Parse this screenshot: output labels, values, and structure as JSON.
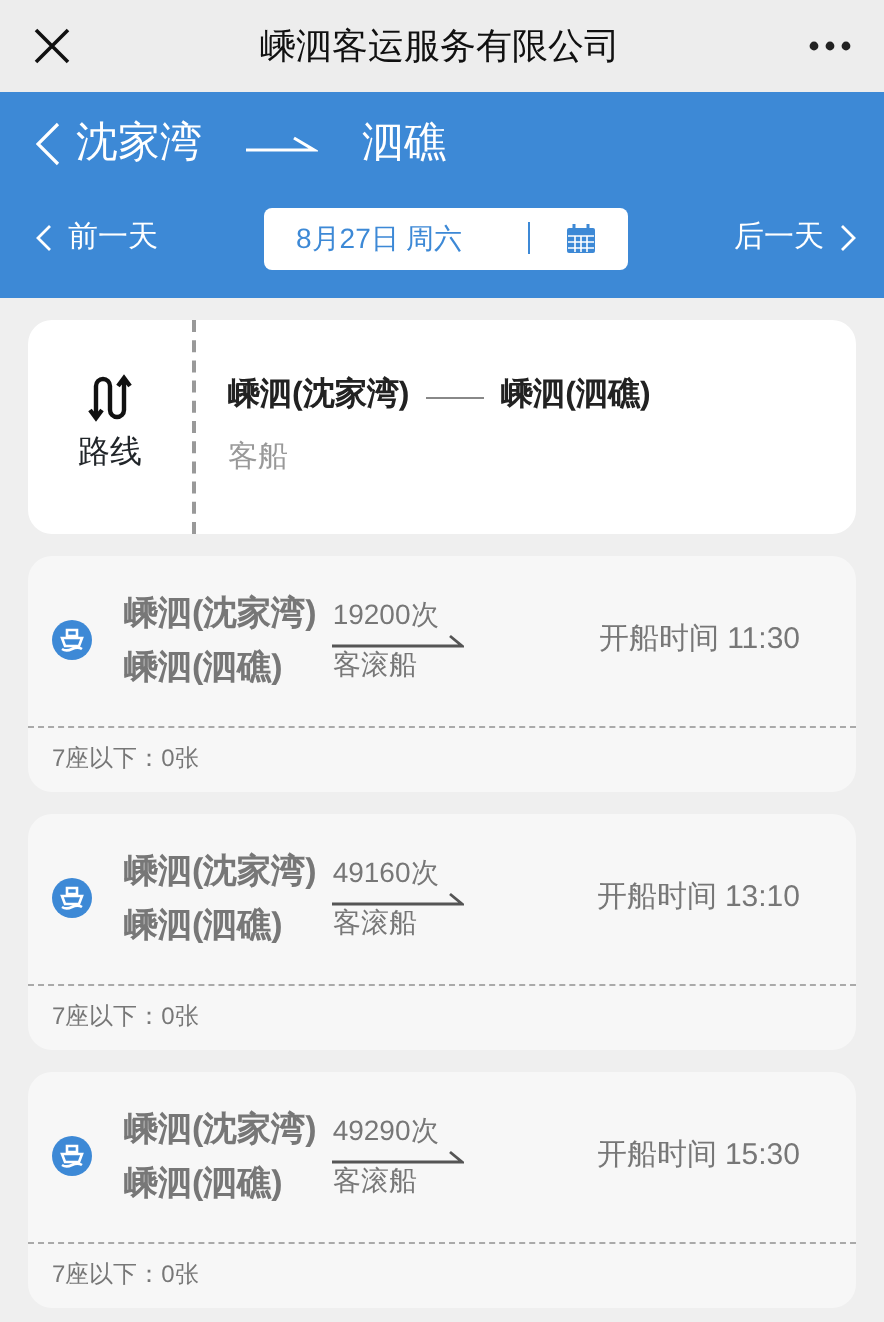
{
  "top_bar": {
    "title": "嵊泗客运服务有限公司"
  },
  "header": {
    "from": "沈家湾",
    "to": "泗礁",
    "prev_day": "前一天",
    "date": "8月27日 周六",
    "next_day": "后一天"
  },
  "route": {
    "label": "路线",
    "from": "嵊泗(沈家湾)",
    "to": "嵊泗(泗礁)",
    "vessel": "客船"
  },
  "trips": [
    {
      "from": "嵊泗(沈家湾)",
      "to": "嵊泗(泗礁)",
      "number": "19200次",
      "vessel": "客滚船",
      "departure": "开船时间 11:30",
      "seats": "7座以下：0张"
    },
    {
      "from": "嵊泗(沈家湾)",
      "to": "嵊泗(泗礁)",
      "number": "49160次",
      "vessel": "客滚船",
      "departure": "开船时间 13:10",
      "seats": "7座以下：0张"
    },
    {
      "from": "嵊泗(沈家湾)",
      "to": "嵊泗(泗礁)",
      "number": "49290次",
      "vessel": "客滚船",
      "departure": "开船时间 15:30",
      "seats": "7座以下：0张"
    }
  ]
}
